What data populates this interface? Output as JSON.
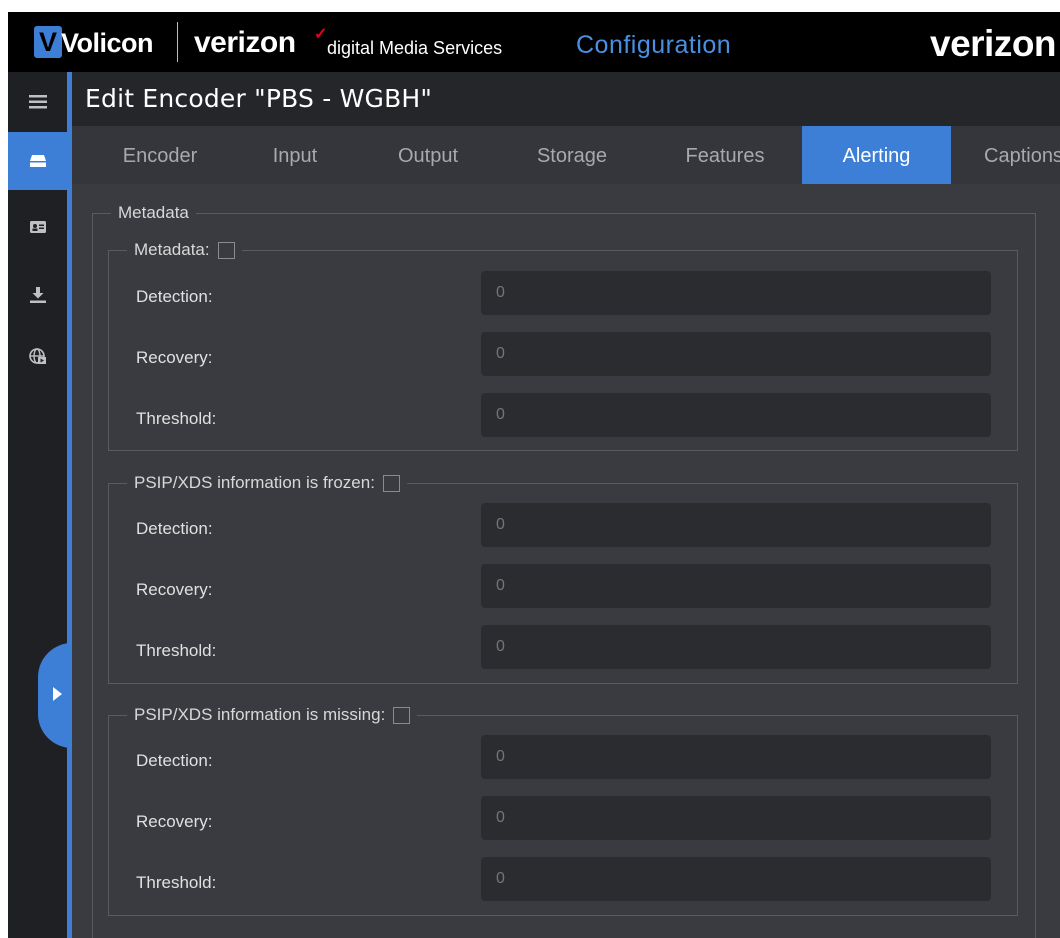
{
  "brand": {
    "logo_text": "Volicon",
    "logo_letter": "V",
    "partner_word": "verizon",
    "partner_check": "✓",
    "partner_sub": "digital Media Services",
    "section_title": "Configuration",
    "right_brand": "verizon"
  },
  "header": {
    "title": "Edit Encoder \"PBS - WGBH\""
  },
  "tabs": [
    {
      "label": "Encoder"
    },
    {
      "label": "Input"
    },
    {
      "label": "Output"
    },
    {
      "label": "Storage"
    },
    {
      "label": "Features"
    },
    {
      "label": "Alerting"
    },
    {
      "label": "Captions"
    }
  ],
  "active_tab": "Alerting",
  "sidebar": {
    "icons": [
      "menu-icon",
      "encoder-icon",
      "contact-card-icon",
      "download-icon",
      "globe-video-icon"
    ],
    "active_index": 1
  },
  "section": {
    "legend": "Metadata",
    "groups": [
      {
        "legend": "Metadata:",
        "checked": false,
        "rows": [
          {
            "label": "Detection:",
            "value": "",
            "placeholder": "0"
          },
          {
            "label": "Recovery:",
            "value": "",
            "placeholder": "0"
          },
          {
            "label": "Threshold:",
            "value": "",
            "placeholder": "0"
          }
        ]
      },
      {
        "legend": "PSIP/XDS information is frozen:",
        "checked": false,
        "rows": [
          {
            "label": "Detection:",
            "value": "",
            "placeholder": "0"
          },
          {
            "label": "Recovery:",
            "value": "",
            "placeholder": "0"
          },
          {
            "label": "Threshold:",
            "value": "",
            "placeholder": "0"
          }
        ]
      },
      {
        "legend": "PSIP/XDS information is missing:",
        "checked": false,
        "rows": [
          {
            "label": "Detection:",
            "value": "",
            "placeholder": "0"
          },
          {
            "label": "Recovery:",
            "value": "",
            "placeholder": "0"
          },
          {
            "label": "Threshold:",
            "value": "",
            "placeholder": "0"
          }
        ]
      }
    ]
  },
  "colors": {
    "accent": "#3d7fd6",
    "topbar": "#000000",
    "rail": "#1f2023",
    "header": "#25262a",
    "tabs": "#35363b",
    "content": "#3a3b40",
    "input": "#2b2c30",
    "brand_check": "#e6001e"
  }
}
